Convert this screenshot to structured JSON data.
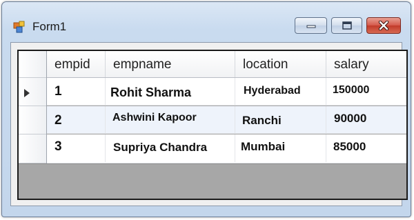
{
  "window": {
    "title": "Form1"
  },
  "grid": {
    "columns": [
      "empid",
      "empname",
      "location",
      "salary"
    ],
    "rows": [
      {
        "empid": "1",
        "empname": "Rohit Sharma",
        "location": "Hyderabad",
        "salary": "150000"
      },
      {
        "empid": "2",
        "empname": "Ashwini Kapoor",
        "location": "Ranchi",
        "salary": "90000"
      },
      {
        "empid": "3",
        "empname": "Supriya Chandra",
        "location": "Mumbai",
        "salary": "85000"
      }
    ],
    "current_row_indicator": "row-pointer-icon"
  },
  "icons": {
    "app": "form-app-icon",
    "minimize": "minimize-icon",
    "maximize": "maximize-icon",
    "close": "close-icon"
  },
  "colors": {
    "close_button": "#d4584a",
    "selected_row": "#eef3fb",
    "empty_area": "#a7a7a7"
  }
}
